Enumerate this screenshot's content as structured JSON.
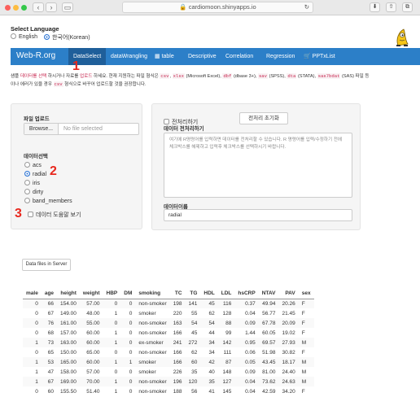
{
  "browser": {
    "url": "cardiomoon.shinyapps.io"
  },
  "language": {
    "title": "Select Language",
    "options": [
      "English",
      "한국어(Korean)"
    ],
    "selected": 1
  },
  "nav": {
    "brand": "Web-R.org",
    "items": [
      "DataSelect",
      "dataWrangling",
      "table",
      "Descriptive",
      "Correlation",
      "Regression",
      "PPTxList"
    ],
    "active": 0
  },
  "description": {
    "part1": "샘플 ",
    "hl1": "데이터를 선택",
    "part2": " 하시거나 자료를 ",
    "hl2": "업로드",
    "part3": " 하세요. 현재 지원하는 파일 형식은 ",
    "c1": "csv",
    "part4": ", ",
    "c2": "xlsx",
    "part5": " (Microsoft Excel), ",
    "c3": "dbf",
    "part6": " (dbase 3+), ",
    "c4": "sav",
    "part7": " (SPSS), ",
    "c5": "dta",
    "part8": " (STATA), ",
    "c6": "sas7bdat",
    "part9": " (SAS) 파일 등",
    "line2a": "이나 에러가 있을 경우 ",
    "c7": "csv",
    "line2b": " 형식으로 바꾸어 업로드할 것을 권장합니다."
  },
  "upload": {
    "label": "파일 업로드",
    "browse": "Browse...",
    "placeholder": "No file selected"
  },
  "dataselect": {
    "label": "데이터선택",
    "options": [
      "acs",
      "radial",
      "iris",
      "dirty",
      "band_members"
    ],
    "selected": 1
  },
  "help_checkbox": "데이터 도움말 보기",
  "annotations": [
    "1",
    "2",
    "3"
  ],
  "preprocess": {
    "checkbox": "전처리하기",
    "reset": "전처리 초기화",
    "label": "데이터 전처리하기",
    "placeholder": "여기에 R명령어를 입력하면 데이터를 전처리할 수 있습니다. R 명령어를 입력/수정하기 전에 체크박스를 해제하고 입력후 체크박스를 선택하시기 바랍니다."
  },
  "dataname": {
    "label": "데이터이름",
    "value": "radial"
  },
  "server_button": "Data files in Server",
  "table": {
    "headers": [
      "male",
      "age",
      "height",
      "weight",
      "HBP",
      "DM",
      "smoking",
      "TC",
      "TG",
      "HDL",
      "LDL",
      "hsCRP",
      "NTAV",
      "PAV",
      "sex"
    ],
    "rows": [
      [
        "0",
        "66",
        "154.00",
        "57.00",
        "0",
        "0",
        "non-smoker",
        "198",
        "141",
        "45",
        "116",
        "0.37",
        "49.94",
        "20.26",
        "F"
      ],
      [
        "0",
        "67",
        "149.00",
        "48.00",
        "1",
        "0",
        "smoker",
        "220",
        "55",
        "62",
        "128",
        "0.04",
        "56.77",
        "21.45",
        "F"
      ],
      [
        "0",
        "76",
        "161.00",
        "55.00",
        "0",
        "0",
        "non-smoker",
        "163",
        "54",
        "54",
        "88",
        "0.09",
        "67.78",
        "20.09",
        "F"
      ],
      [
        "0",
        "68",
        "157.00",
        "60.00",
        "1",
        "0",
        "non-smoker",
        "166",
        "45",
        "44",
        "99",
        "1.44",
        "60.05",
        "19.02",
        "F"
      ],
      [
        "1",
        "73",
        "163.00",
        "60.00",
        "1",
        "0",
        "ex-smoker",
        "241",
        "272",
        "34",
        "142",
        "0.95",
        "69.57",
        "27.93",
        "M"
      ],
      [
        "0",
        "65",
        "150.00",
        "65.00",
        "0",
        "0",
        "non-smoker",
        "166",
        "62",
        "34",
        "111",
        "0.06",
        "51.98",
        "30.82",
        "F"
      ],
      [
        "1",
        "53",
        "165.00",
        "60.00",
        "1",
        "1",
        "smoker",
        "166",
        "60",
        "42",
        "87",
        "0.05",
        "43.45",
        "18.17",
        "M"
      ],
      [
        "1",
        "47",
        "158.00",
        "57.00",
        "0",
        "0",
        "smoker",
        "226",
        "35",
        "40",
        "148",
        "0.09",
        "81.00",
        "24.40",
        "M"
      ],
      [
        "1",
        "67",
        "169.00",
        "70.00",
        "1",
        "0",
        "non-smoker",
        "196",
        "120",
        "35",
        "127",
        "0.04",
        "73.62",
        "24.63",
        "M"
      ],
      [
        "0",
        "60",
        "155.50",
        "51.40",
        "1",
        "0",
        "non-smoker",
        "188",
        "56",
        "41",
        "145",
        "0.04",
        "42.59",
        "34.20",
        "F"
      ]
    ]
  }
}
